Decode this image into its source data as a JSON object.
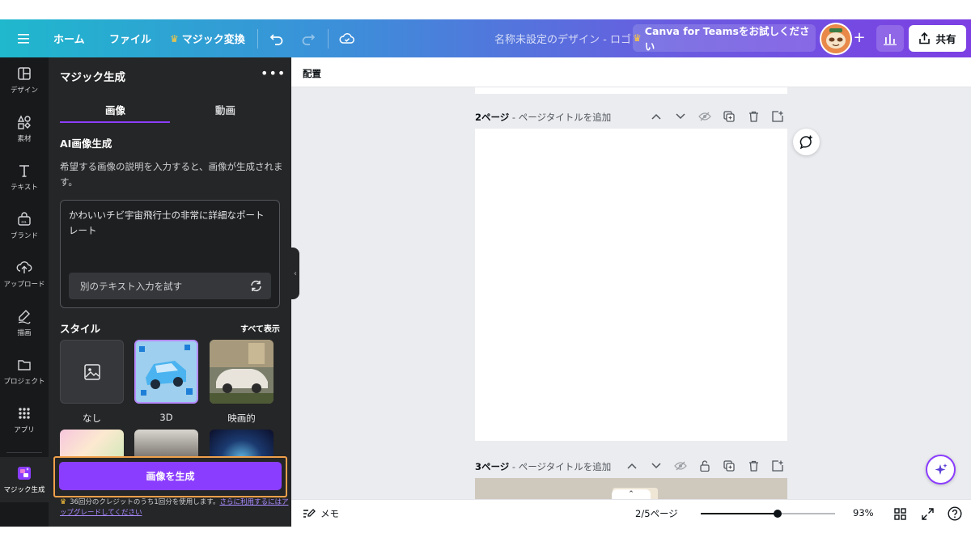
{
  "topbar": {
    "home": "ホーム",
    "file": "ファイル",
    "magic_convert": "マジック変換",
    "design_title": "名称未設定のデザイン - ロゴ",
    "teams_trial": "Canva for Teamsをお試しください",
    "share": "共有",
    "plus": "+"
  },
  "rail": {
    "items": [
      {
        "label": "デザイン",
        "icon": "layout-icon"
      },
      {
        "label": "素材",
        "icon": "elements-icon"
      },
      {
        "label": "テキスト",
        "icon": "text-icon"
      },
      {
        "label": "ブランド",
        "icon": "brand-icon"
      },
      {
        "label": "アップロード",
        "icon": "upload-icon"
      },
      {
        "label": "描画",
        "icon": "draw-icon"
      },
      {
        "label": "プロジェクト",
        "icon": "folder-icon"
      },
      {
        "label": "アプリ",
        "icon": "apps-icon"
      },
      {
        "label": "マジック生成",
        "icon": "magic-media-icon"
      }
    ]
  },
  "panel": {
    "title": "マジック生成",
    "more": "•••",
    "tabs": [
      "画像",
      "動画"
    ],
    "ai_title": "AI画像生成",
    "ai_desc": "希望する画像の説明を入力すると、画像が生成されます。",
    "prompt": "かわいいチビ宇宙飛行士の非常に詳細なポートレート",
    "alt_prompt": "別のテキスト入力を試す",
    "style_title": "スタイル",
    "style_all": "すべて表示",
    "styles": [
      "なし",
      "3D",
      "映画的"
    ],
    "generate": "画像を生成",
    "credit_prefix": "36回分のクレジットのうち1回分を使用します。",
    "credit_link": "さらに利用するにはアップグレードしてください"
  },
  "canvas": {
    "arrange": "配置",
    "page2_num": "2ページ",
    "page2_title": " - ページタイトルを追加",
    "page3_num": "3ページ",
    "page3_title": " - ページタイトルを追加"
  },
  "bottombar": {
    "memo": "メモ",
    "page_count": "2/5ページ",
    "zoom": "93%",
    "zoom_fraction": 0.57
  },
  "colors": {
    "accent": "#8b3dff",
    "highlight": "#f0a04b",
    "panel_bg": "#252627",
    "rail_bg": "#18191b"
  }
}
